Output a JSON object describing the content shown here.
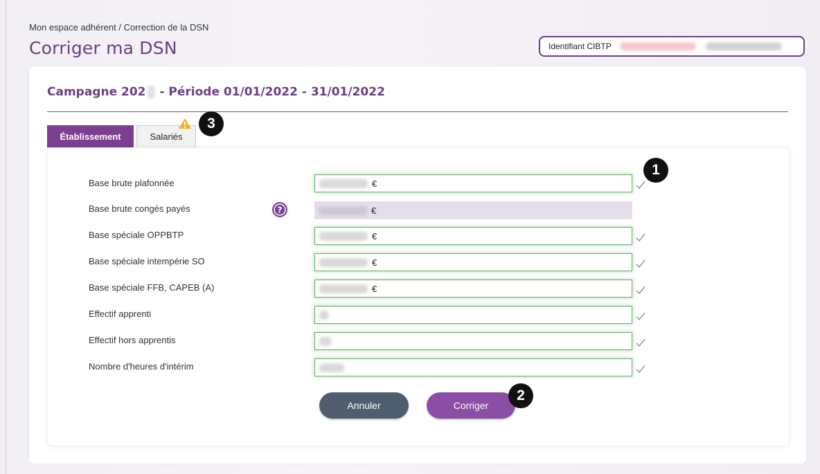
{
  "breadcrumb": "Mon espace adhérent / Correction de la DSN",
  "page_title": "Corriger ma DSN",
  "identifier": {
    "label": "Identifiant CIBTP"
  },
  "campaign": {
    "part1": "Campagne 202",
    "part2": "- Période 01/01/2022 - 31/01/2022"
  },
  "tabs": [
    {
      "label": "Établissement",
      "active": true
    },
    {
      "label": "Salariés",
      "active": false
    }
  ],
  "fields": [
    {
      "label": "Base brute plafonnée",
      "currency": "€"
    },
    {
      "label": "Base brute congés payés",
      "currency": "€",
      "readonly": true
    },
    {
      "label": "Base spéciale OPPBTP",
      "currency": "€"
    },
    {
      "label": "Base spéciale intempérie SO",
      "currency": "€"
    },
    {
      "label": "Base spéciale FFB, CAPEB (A)",
      "currency": "€"
    },
    {
      "label": "Effectif apprenti"
    },
    {
      "label": "Effectif hors apprentis"
    },
    {
      "label": "Nombre d'heures d'intérim"
    }
  ],
  "buttons": {
    "cancel": "Annuler",
    "correct": "Corriger"
  },
  "badges": [
    "1",
    "2",
    "3"
  ],
  "colors": {
    "brand": "#6b3f82",
    "valid": "#6aa86a",
    "cancel": "#4f5e6e",
    "correct": "#8a4ea4"
  }
}
